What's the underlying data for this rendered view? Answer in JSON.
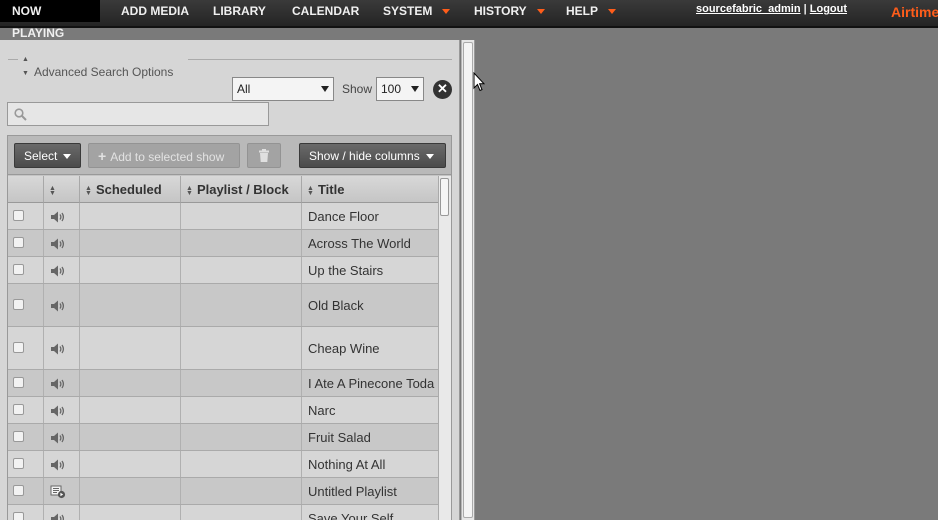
{
  "nav": {
    "items": [
      {
        "label": "NOW PLAYING",
        "active": true,
        "has_menu": false
      },
      {
        "label": "ADD MEDIA",
        "active": false,
        "has_menu": false
      },
      {
        "label": "LIBRARY",
        "active": false,
        "has_menu": false
      },
      {
        "label": "CALENDAR",
        "active": false,
        "has_menu": false
      },
      {
        "label": "SYSTEM",
        "active": false,
        "has_menu": true
      },
      {
        "label": "HISTORY",
        "active": false,
        "has_menu": true
      },
      {
        "label": "HELP",
        "active": false,
        "has_menu": true
      }
    ],
    "user": "sourcefabric_admin",
    "separator": "|",
    "logout": "Logout",
    "logo": "Airtime"
  },
  "library": {
    "advanced_search_label": "Advanced Search Options",
    "filter_value": "All",
    "show_label": "Show",
    "show_value": "100",
    "close_icon": "close-icon",
    "search_placeholder": "",
    "search_value": ""
  },
  "toolbar": {
    "select_label": "Select",
    "add_label": "Add to selected show",
    "trash_icon": "trash-icon",
    "columns_label": "Show / hide columns"
  },
  "table": {
    "columns": [
      "",
      "",
      "Scheduled",
      "Playlist / Block",
      "Title"
    ],
    "rows": [
      {
        "type": "audio",
        "title": "Dance Floor"
      },
      {
        "type": "audio",
        "title": "Across The World"
      },
      {
        "type": "audio",
        "title": "Up the Stairs"
      },
      {
        "type": "audio",
        "title": "Old Black"
      },
      {
        "type": "audio",
        "title": "Cheap Wine"
      },
      {
        "type": "audio",
        "title": "I Ate A Pinecone Toda"
      },
      {
        "type": "audio",
        "title": "Narc"
      },
      {
        "type": "audio",
        "title": "Fruit Salad"
      },
      {
        "type": "audio",
        "title": "Nothing At All"
      },
      {
        "type": "playlist",
        "title": "Untitled Playlist"
      },
      {
        "type": "audio",
        "title": "Save Your Self"
      }
    ]
  },
  "colors": {
    "accent": "#ff5d1a",
    "nav_bg": "#2a2a2a",
    "workspace_bg": "#7a7a7a"
  }
}
